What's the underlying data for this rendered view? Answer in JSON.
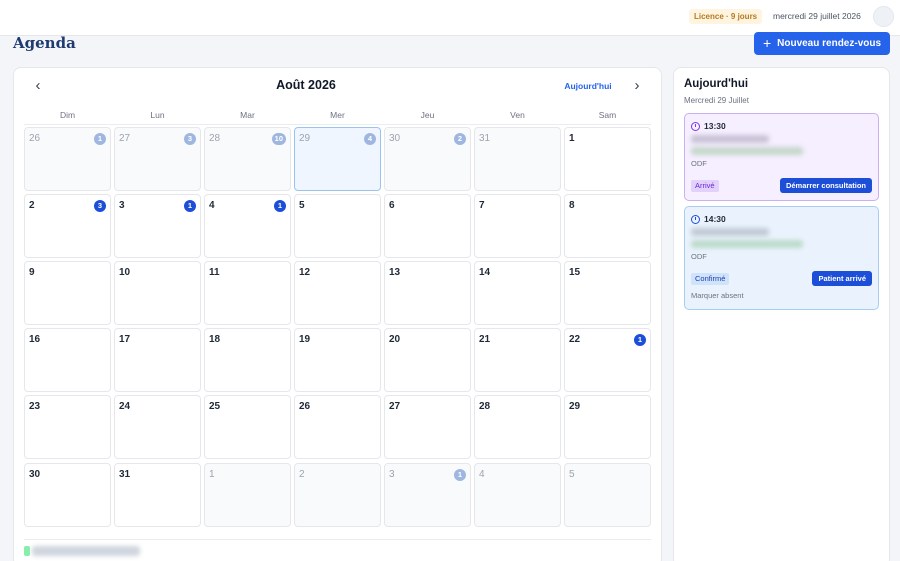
{
  "topbar": {
    "licence": "Licence · 9 jours",
    "date": "mercredi 29 juillet 2026"
  },
  "page": {
    "title": "Agenda",
    "new_button": "Nouveau rendez-vous"
  },
  "calendar": {
    "month": "Août 2026",
    "today_label": "Aujourd'hui",
    "weekdays": [
      "Dim",
      "Lun",
      "Mar",
      "Mer",
      "Jeu",
      "Ven",
      "Sam"
    ],
    "weeks": [
      [
        {
          "day": "26",
          "badge": "1",
          "muted": true
        },
        {
          "day": "27",
          "badge": "3",
          "muted": true
        },
        {
          "day": "28",
          "badge": "10",
          "muted": true
        },
        {
          "day": "29",
          "badge": "4",
          "muted": true,
          "selected": true
        },
        {
          "day": "30",
          "badge": "2",
          "muted": true
        },
        {
          "day": "31",
          "badge": "",
          "muted": true
        },
        {
          "day": "1",
          "badge": "",
          "muted": false
        }
      ],
      [
        {
          "day": "2",
          "badge": "3",
          "muted": false
        },
        {
          "day": "3",
          "badge": "1",
          "muted": false
        },
        {
          "day": "4",
          "badge": "1",
          "muted": false
        },
        {
          "day": "5",
          "badge": "",
          "muted": false
        },
        {
          "day": "6",
          "badge": "",
          "muted": false
        },
        {
          "day": "7",
          "badge": "",
          "muted": false
        },
        {
          "day": "8",
          "badge": "",
          "muted": false
        }
      ],
      [
        {
          "day": "9",
          "badge": "",
          "muted": false
        },
        {
          "day": "10",
          "badge": "",
          "muted": false
        },
        {
          "day": "11",
          "badge": "",
          "muted": false
        },
        {
          "day": "12",
          "badge": "",
          "muted": false
        },
        {
          "day": "13",
          "badge": "",
          "muted": false
        },
        {
          "day": "14",
          "badge": "",
          "muted": false
        },
        {
          "day": "15",
          "badge": "",
          "muted": false
        }
      ],
      [
        {
          "day": "16",
          "badge": "",
          "muted": false
        },
        {
          "day": "17",
          "badge": "",
          "muted": false
        },
        {
          "day": "18",
          "badge": "",
          "muted": false
        },
        {
          "day": "19",
          "badge": "",
          "muted": false
        },
        {
          "day": "20",
          "badge": "",
          "muted": false
        },
        {
          "day": "21",
          "badge": "",
          "muted": false
        },
        {
          "day": "22",
          "badge": "1",
          "muted": false
        }
      ],
      [
        {
          "day": "23",
          "badge": "",
          "muted": false
        },
        {
          "day": "24",
          "badge": "",
          "muted": false
        },
        {
          "day": "25",
          "badge": "",
          "muted": false
        },
        {
          "day": "26",
          "badge": "",
          "muted": false
        },
        {
          "day": "27",
          "badge": "",
          "muted": false
        },
        {
          "day": "28",
          "badge": "",
          "muted": false
        },
        {
          "day": "29",
          "badge": "",
          "muted": false
        }
      ],
      [
        {
          "day": "30",
          "badge": "",
          "muted": false
        },
        {
          "day": "31",
          "badge": "",
          "muted": false
        },
        {
          "day": "1",
          "badge": "",
          "muted": true
        },
        {
          "day": "2",
          "badge": "",
          "muted": true
        },
        {
          "day": "3",
          "badge": "1",
          "muted": true
        },
        {
          "day": "4",
          "badge": "",
          "muted": true
        },
        {
          "day": "5",
          "badge": "",
          "muted": true
        }
      ]
    ]
  },
  "side": {
    "title": "Aujourd'hui",
    "subtitle": "Mercredi 29 Juillet",
    "appointments": [
      {
        "time": "13:30",
        "type": "ODF",
        "status": "Arrivé",
        "action": "Démarrer consultation"
      },
      {
        "time": "14:30",
        "type": "ODF",
        "status": "Confirmé",
        "action": "Patient arrivé",
        "secondary": "Marquer absent"
      }
    ]
  },
  "colors": {
    "primary": "#2563eb",
    "badge": "#1d4ed8",
    "badge_muted": "#9fb7e0",
    "title": "#1e3a6e",
    "licence_bg": "#fff4e0",
    "licence_text": "#b7791f"
  }
}
